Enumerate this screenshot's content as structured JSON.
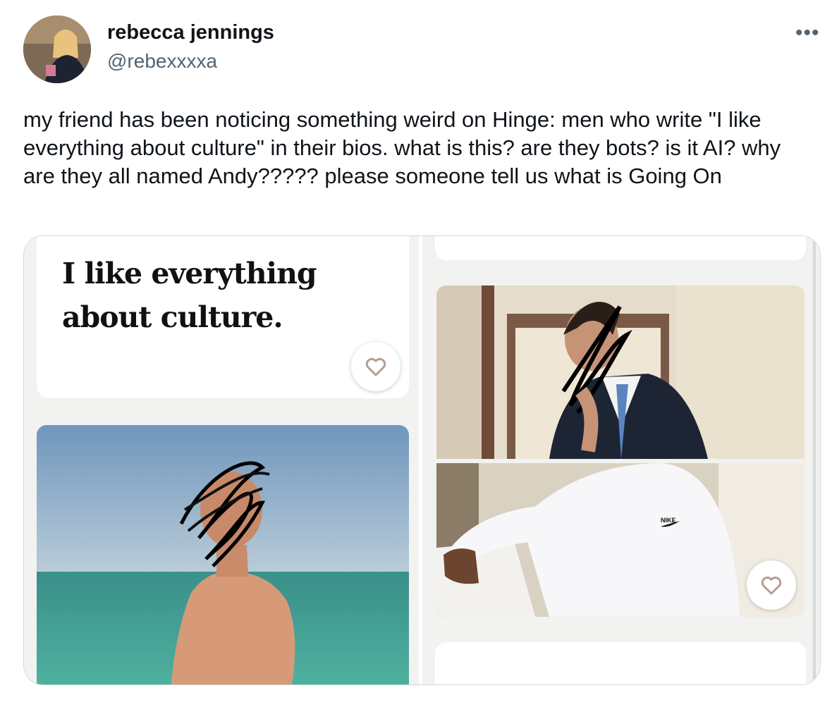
{
  "tweet": {
    "author_name": "rebecca jennings",
    "author_handle": "@rebexxxxa",
    "more_icon": "more-dots-icon",
    "text": "my friend has been noticing something weird on Hinge: men who write \"I like everything about culture\" in their bios. what is this? are they bots? is it AI? why are they all named Andy????? please someone tell us what is Going On"
  },
  "screenshot": {
    "prompt_answer": "I like everything about culture.",
    "like_icon": "heart-icon",
    "photos": [
      {
        "id": "beach-photo",
        "description_icon": "photo-shirtless-man-beach"
      },
      {
        "id": "suit-photo",
        "description_icon": "photo-man-in-suit"
      },
      {
        "id": "sweatshirt-photo",
        "description_icon": "photo-man-white-sweatshirt"
      }
    ],
    "sweatshirt_logo": "NIKE"
  },
  "colors": {
    "secondary_text": "#536471",
    "hinge_heart": "#b89b92",
    "media_border": "#cfd9de"
  }
}
